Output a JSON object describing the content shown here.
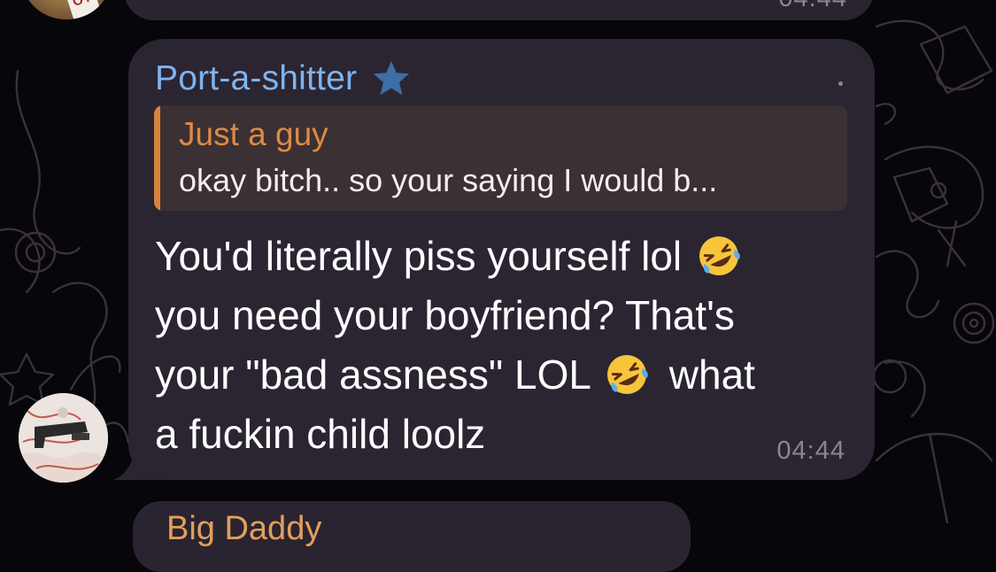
{
  "previous_message": {
    "time": "04:44"
  },
  "message": {
    "sender": "Port-a-shitter",
    "reply": {
      "author": "Just a guy",
      "snippet": "okay bitch.. so your saying I would b..."
    },
    "lines": [
      "You'd literally piss yourself lol",
      "you need your boyfriend? That's",
      "your \"bad assness\" LOL",
      "what",
      "a fuckin child loolz"
    ],
    "time": "04:44"
  },
  "next_message": {
    "sender_partial": "Big Daddy"
  },
  "colors": {
    "background": "#07060a",
    "bubble": "#2b2532",
    "sender_name": "#7fb4ee",
    "reply_accent": "#d8833c",
    "timestamp": "#8d8394"
  },
  "icons": [
    "star-icon",
    "rofl-emoji-icon"
  ]
}
